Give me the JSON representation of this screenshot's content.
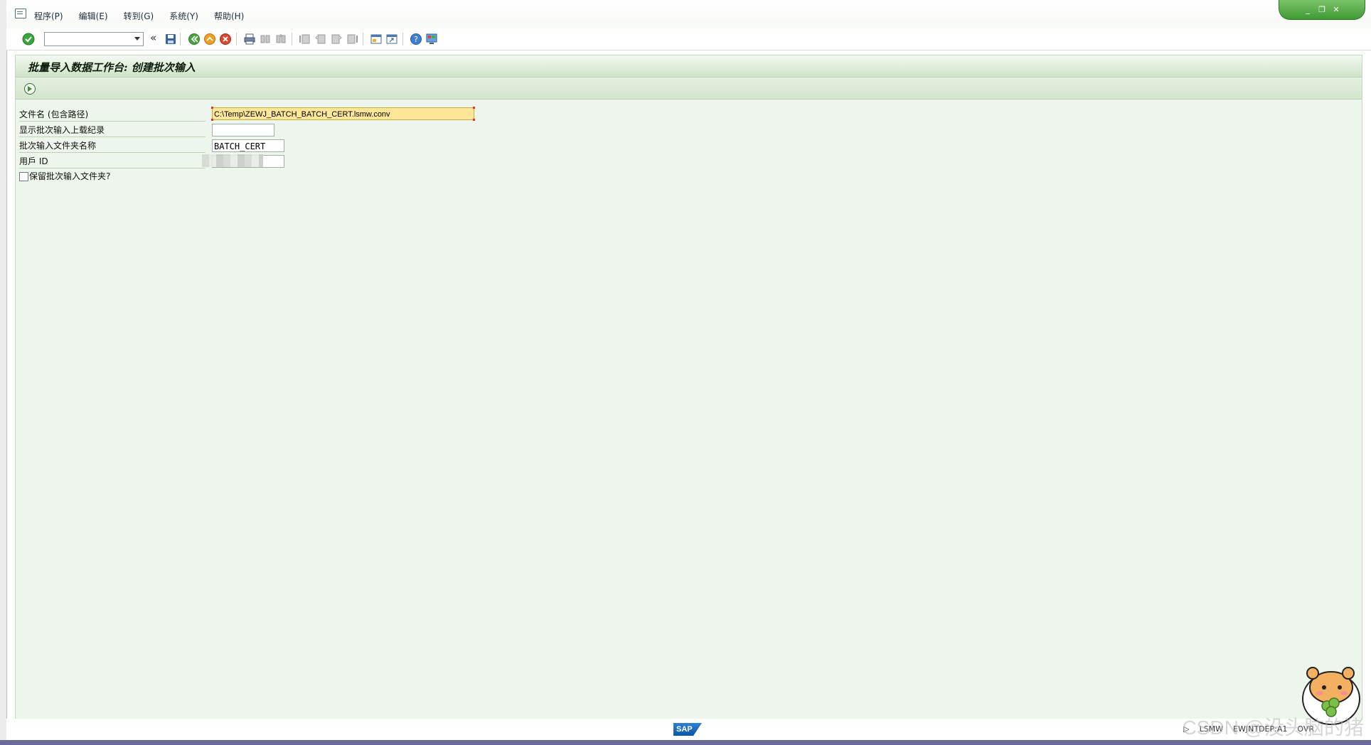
{
  "menubar": {
    "items": [
      "程序(P)",
      "编辑(E)",
      "转到(G)",
      "系统(Y)",
      "帮助(H)"
    ]
  },
  "window_controls": {
    "minimize": "_",
    "restore": "❐",
    "close": "✕"
  },
  "toolbar": {
    "back_glyph": "«",
    "icons": [
      "enter-icon",
      "command-field",
      "save-icon",
      "back-icon",
      "exit-icon",
      "cancel-icon",
      "print-icon",
      "find-icon",
      "find-next-icon",
      "first-page-icon",
      "previous-page-icon",
      "next-page-icon",
      "last-page-icon",
      "create-session-icon",
      "shortcut-icon",
      "help-icon",
      "customize-layout-icon"
    ]
  },
  "page": {
    "title": "批量导入数据工作台: 创建批次输入"
  },
  "form": {
    "file_name_label": "文件名 (包含路径)",
    "file_name_value": "C:\\Temp\\ZEWJ_BATCH_BATCH_CERT.lsmw.conv",
    "show_last_records_label": "显示批次输入上载纪录",
    "show_last_records_value": "",
    "folder_name_label": "批次输入文件夹名称",
    "folder_name_value": "BATCH_CERT",
    "user_id_label": "用戶 ID",
    "user_id_value": "",
    "keep_folder_label": "保留批次输入文件夹?"
  },
  "statusbar": {
    "sap_logo": "SAP",
    "transaction": "LSMW",
    "system": "EWJNTDEP:A1",
    "mode": "OVR"
  },
  "watermark": "CSDN @没头脑的猪",
  "colors": {
    "title_gradient_top": "#f4f9f2",
    "title_gradient_bottom": "#cfe4c8",
    "main_bg": "#eef5ec",
    "active_field": "#ffe79a",
    "window_controls": "#3f9a33"
  }
}
